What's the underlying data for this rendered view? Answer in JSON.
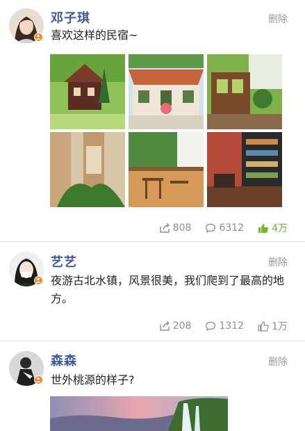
{
  "posts": [
    {
      "name": "邓子琪",
      "delete_label": "删除",
      "text": "喜欢这样的民宿~",
      "share": "808",
      "comment": "6312",
      "like": "4万",
      "liked": true
    },
    {
      "name": "艺艺",
      "delete_label": "删除",
      "text": "夜游古北水镇，风景很美，我们爬到了最高的地方。",
      "share": "208",
      "comment": "1312",
      "like": "1万",
      "liked": false
    },
    {
      "name": "森森",
      "delete_label": "删除",
      "text": "世外桃源的样子?"
    }
  ],
  "colors": {
    "name": "#3b5a99",
    "liked": "#7ab52e",
    "badge": "#f28a2b"
  },
  "icons": [
    "share-icon",
    "comment-icon",
    "like-icon",
    "verified-badge-icon"
  ]
}
